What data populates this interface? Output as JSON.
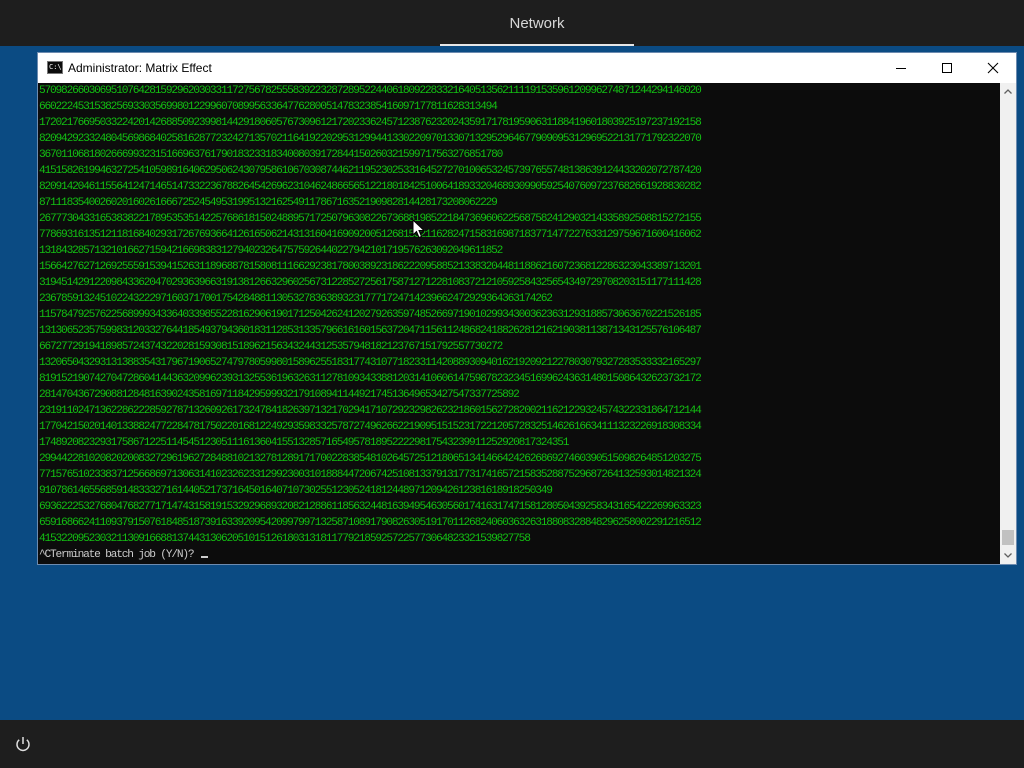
{
  "top_bar": {
    "tab_label": "Network"
  },
  "console_window": {
    "title": "Administrator:  Matrix Effect",
    "icon_text": "C:\\",
    "lines": [
      "570982660306951076428159296203033117275678255583922328728952244061809228332164051356211119153596120996274871244294146020",
      "66022245315382569330356998012299607089956336477628005147832385416097177811628313494",
      "172021766950332242014268850923998144291806057673096121720233624571238762320243591717819590631188419601803925197237192158",
      "820942923324804569868402581628772324271357021164192202953129944133022097013307132952964677909095312969522131771792322070",
      "367011068180266699323151669637617901832331834008039172844150260321599717563276851780",
      "415158261994632725410598916406295062430795861067030874462119523025331645272701006532457397655748138639124433202072787420",
      "820914204611556412471465147332236788264542696231046248665651221801842510064189332046893099059254076097237682661928830282",
      "87111835400260201602616667252454953199513216254911786716352190982814428173208062229",
      "267773043316538382217895353514225768618150248895717250796308226736881985221847369606225687582412903214335892508815272155",
      "778693161351211816840293172676936641261650621431316041690920051268153211628247158316987183771477227633129759671600416062",
      "131843285713210166271594216698383127940232647575926440227942101719576263092049611852",
      "156642762712692555915394152631189688781580811166292381780038923186222095885213383204481188621607236812286323043389713201",
      "319451429122098433620470293639663191381266329602567312285272561758712712281083721210592584325654349729708203151177111428",
      "236785913245102243222971603717001754284881130532783638932317771724714239662472929364363174262",
      "115784792576225689993433640339855228162906190171250426241202792635974852669719010299343003623631293188573063670221526185",
      "131306523575998312033276441854937943601831128531335796616160156372047115611248682418826281216219038113871343125576106487",
      "667277291941898572437432202815930815189621563432443125357948182123767151792557730272",
      "132065043293131388354317967190652747978059980158962551831774310771823311420889309401621920921227803079327283533332165297",
      "819152190742704728604144363209962393132553619632631127810934338812031410606147598782323451699624363148015086432623732172",
      "281470436729088128481639024358169711842959993217910894114492174513649653427547337725892",
      "231911024713622862228592787132609261732478418263971321702941710729232982623218601562728200211621229324574322331864712144",
      "177042150201401338824772284781750220168122492935983325787274962662219095151523172212057283251462616634111323226918308334",
      "174892082329317586712251145451230511161360415513285716549578189522229817543239911252920817324351",
      "299442281020820200832729619627284881021327812891717002283854810264572512180651341466424262686927460390515098264851203275",
      "771576510233837125668697130631410232623312992300310188844720674251081337913177317416572158352887529687264132593014821324",
      "910786146556859148333271614405217371645016407107302551230524181244897120942612381618918250349",
      "693622253276804768277171474315819153292968932082128861185632448163949546305601741631747158128050439258343165422269963323",
      "659168662411093791507618485187391633920954209979971325871089179082630519170112682406036326318808328848296258002291216512",
      "41532209523032113091668813744313062051015126180313181177921859257225773064823321539827758"
    ],
    "prompt_line": "^CTerminate batch job (Y/N)? "
  },
  "colors": {
    "desktop_background": "#0b4b83",
    "taskbar": "#1e1e1e",
    "console_background": "#0c0c0c",
    "matrix_text": "#13c013",
    "prompt_text": "#cccccc"
  },
  "icons": {
    "app": "console-icon",
    "minimize": "minimize-icon",
    "maximize": "maximize-icon",
    "close": "close-icon",
    "power": "power-icon",
    "scroll_up": "chevron-up-icon",
    "scroll_down": "chevron-down-icon"
  }
}
